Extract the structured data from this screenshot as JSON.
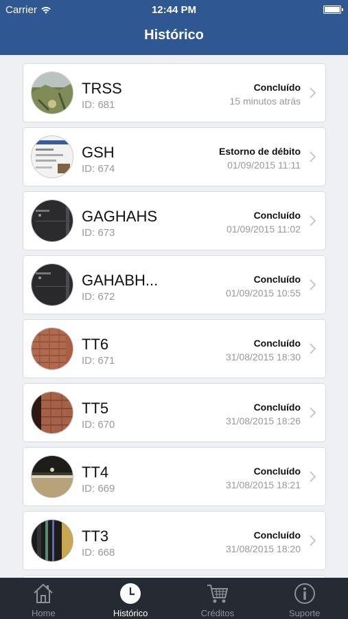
{
  "status_bar": {
    "carrier": "Carrier",
    "time": "12:44 PM"
  },
  "nav": {
    "title": "Histórico"
  },
  "items": [
    {
      "name": "TRSS",
      "id": "ID: 681",
      "status": "Concluído",
      "date": "15 minutos atrás",
      "thumb": "photo-grass"
    },
    {
      "name": "GSH",
      "id": "ID: 674",
      "status": "Estorno de débito",
      "date": "01/09/2015 11:11",
      "thumb": "photo-screen-light"
    },
    {
      "name": "GAGHAHS",
      "id": "ID: 673",
      "status": "Concluído",
      "date": "01/09/2015 11:02",
      "thumb": "photo-screen-dark"
    },
    {
      "name": "GAHABH...",
      "id": "ID: 672",
      "status": "Concluído",
      "date": "01/09/2015 10:55",
      "thumb": "photo-screen-dark"
    },
    {
      "name": "TT6",
      "id": "ID: 671",
      "status": "Concluído",
      "date": "31/08/2015 18:30",
      "thumb": "photo-brick"
    },
    {
      "name": "TT5",
      "id": "ID: 670",
      "status": "Concluído",
      "date": "31/08/2015 18:26",
      "thumb": "photo-brick-dark"
    },
    {
      "name": "TT4",
      "id": "ID: 669",
      "status": "Concluído",
      "date": "31/08/2015 18:21",
      "thumb": "photo-room"
    },
    {
      "name": "TT3",
      "id": "ID: 668",
      "status": "Concluído",
      "date": "31/08/2015 18:20",
      "thumb": "photo-door"
    }
  ],
  "tabbar": {
    "tabs": [
      {
        "label": "Home",
        "icon": "home-icon",
        "active": false
      },
      {
        "label": "Histórico",
        "icon": "clock-icon",
        "active": true
      },
      {
        "label": "Créditos",
        "icon": "cart-icon",
        "active": false
      },
      {
        "label": "Suporte",
        "icon": "info-icon",
        "active": false
      }
    ]
  },
  "colors": {
    "header": "#2f5792",
    "background": "#eff0f4",
    "tabbar": "#262b33"
  }
}
